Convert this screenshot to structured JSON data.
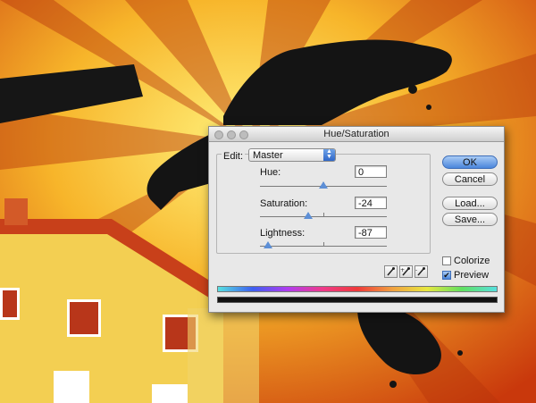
{
  "dialog": {
    "title": "Hue/Saturation",
    "edit_label": "Edit:",
    "edit_value": "Master",
    "hue": {
      "label": "Hue:",
      "value": "0",
      "level": 0.5
    },
    "saturation": {
      "label": "Saturation:",
      "value": "-24",
      "level": 0.38
    },
    "lightness": {
      "label": "Lightness:",
      "value": "-87",
      "level": 0.065
    },
    "buttons": {
      "ok": "OK",
      "cancel": "Cancel",
      "load": "Load...",
      "save": "Save..."
    },
    "colorize": {
      "label": "Colorize",
      "checked": false
    },
    "preview": {
      "label": "Preview",
      "checked": true,
      "mark": "✔"
    },
    "eyedropper_icons": [
      "eyedropper-icon",
      "eyedropper-plus-icon",
      "eyedropper-minus-icon"
    ]
  },
  "colors": {
    "accent": "#4a86db",
    "background_orange": "#e8741a",
    "background_yellow": "#f5d23a"
  }
}
